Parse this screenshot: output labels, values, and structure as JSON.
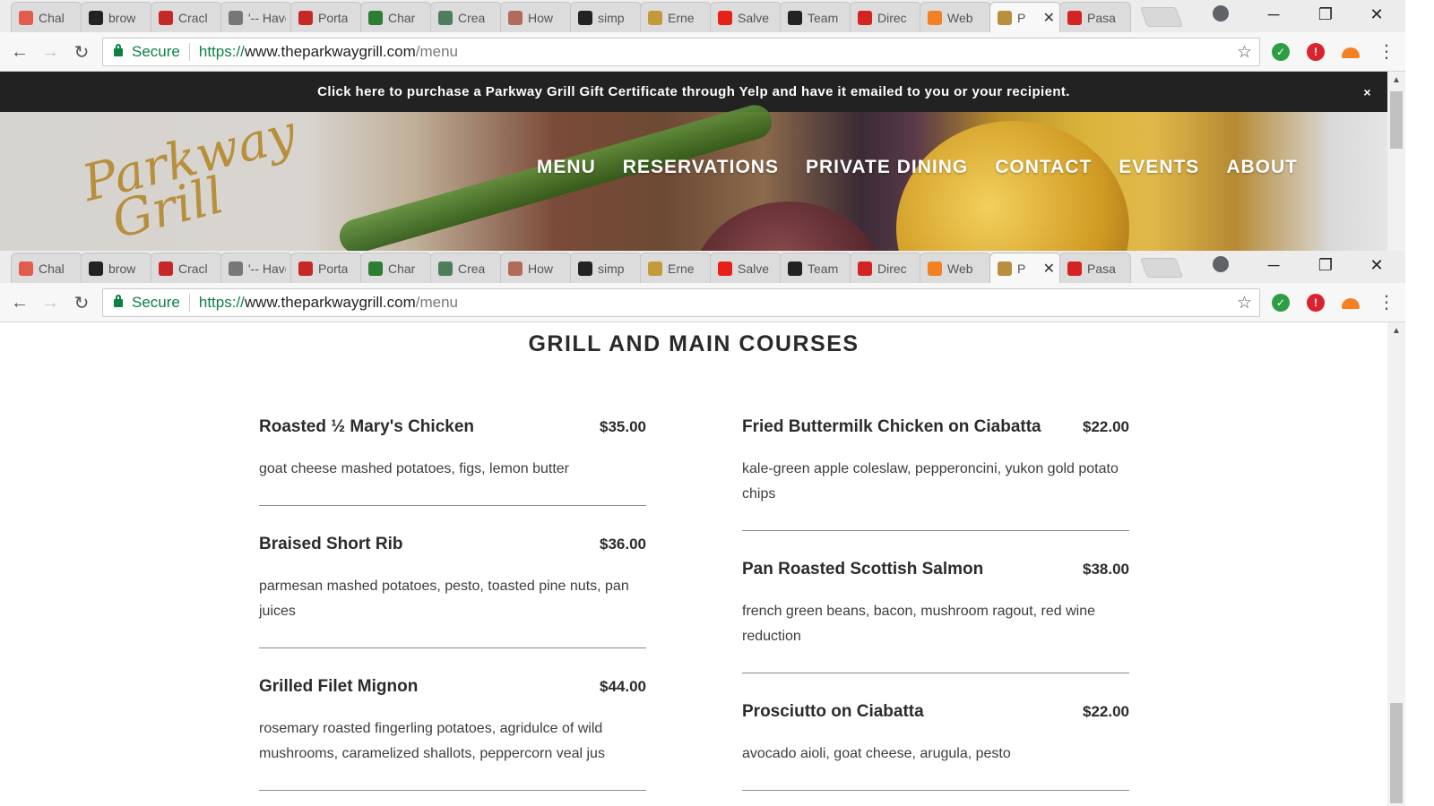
{
  "browser": {
    "tabs": [
      {
        "title": "Chal",
        "favicon": "target-icon",
        "color": "#e25b4b"
      },
      {
        "title": "brow",
        "favicon": "github-icon",
        "color": "#222222"
      },
      {
        "title": "Cracl",
        "favicon": "d-logo-icon",
        "color": "#c62828"
      },
      {
        "title": "'-- Have",
        "favicon": "quote-icon",
        "color": "#777777"
      },
      {
        "title": "Porta",
        "favicon": "portal-icon",
        "color": "#c62828"
      },
      {
        "title": "Char",
        "favicon": "windows-icon",
        "color": "#2d7d32"
      },
      {
        "title": "Crea",
        "favicon": "image-icon",
        "color": "#4e7d5b"
      },
      {
        "title": "How",
        "favicon": "avatar-icon",
        "color": "#b26a5a"
      },
      {
        "title": "simp",
        "favicon": "github-icon",
        "color": "#222222"
      },
      {
        "title": "Erne",
        "favicon": "g-icon",
        "color": "#c29a3c"
      },
      {
        "title": "Salve",
        "favicon": "youtube-icon",
        "color": "#e62117"
      },
      {
        "title": "Team",
        "favicon": "github-icon",
        "color": "#222222"
      },
      {
        "title": "Direc",
        "favicon": "yelp-icon",
        "color": "#d32323"
      },
      {
        "title": "Web",
        "favicon": "cloud-icon",
        "color": "#f48024"
      },
      {
        "title": "P",
        "favicon": "parkway-icon",
        "color": "#b88f3c",
        "active": true
      },
      {
        "title": "Pasa",
        "favicon": "yelp-icon",
        "color": "#d32323"
      }
    ],
    "secure_label": "Secure",
    "url_scheme": "https://",
    "url_host": "www.theparkwaygrill.com",
    "url_path": "/menu",
    "close_tab_glyph": "✕"
  },
  "banner": {
    "text": "Click here to purchase a Parkway Grill Gift Certificate through Yelp and have it emailed to you or your recipient.",
    "close": "×"
  },
  "logo": {
    "line1": "Parkway",
    "line2": "Grill"
  },
  "nav": [
    "MENU",
    "RESERVATIONS",
    "PRIVATE DINING",
    "CONTACT",
    "EVENTS",
    "ABOUT"
  ],
  "section": {
    "title": "GRILL AND MAIN COURSES"
  },
  "menu": {
    "left": [
      {
        "name": "Roasted ½ Mary's Chicken",
        "price": "$35.00",
        "desc": "goat cheese mashed potatoes, figs, lemon butter"
      },
      {
        "name": "Braised Short Rib",
        "price": "$36.00",
        "desc": "parmesan mashed potatoes, pesto, toasted pine nuts, pan juices"
      },
      {
        "name": "Grilled Filet Mignon",
        "price": "$44.00",
        "desc": "rosemary roasted fingerling potatoes, agridulce of wild mushrooms, caramelized shallots, peppercorn veal jus"
      }
    ],
    "right": [
      {
        "name": "Fried Buttermilk Chicken on Ciabatta",
        "price": "$22.00",
        "desc": "kale-green apple coleslaw, pepperoncini, yukon gold potato chips"
      },
      {
        "name": "Pan Roasted Scottish Salmon",
        "price": "$38.00",
        "desc": "french green beans, bacon, mushroom ragout, red wine reduction"
      },
      {
        "name": "Prosciutto on Ciabatta",
        "price": "$22.00",
        "desc": "avocado aioli, goat cheese, arugula, pesto"
      }
    ]
  }
}
